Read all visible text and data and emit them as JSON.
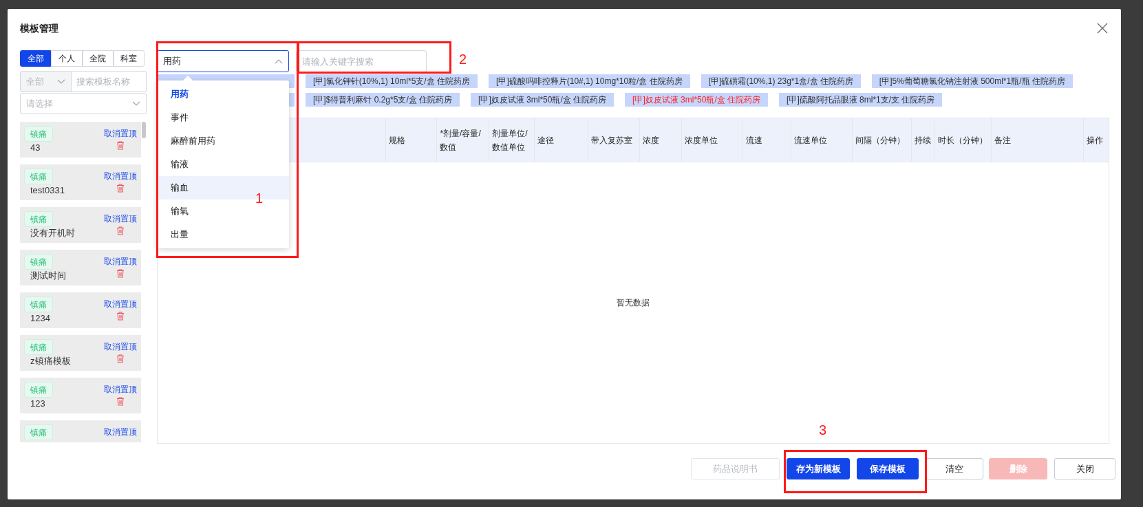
{
  "dialog": {
    "title": "模板管理"
  },
  "scope_tabs": [
    {
      "label": "全部",
      "selected": true
    },
    {
      "label": "个人",
      "selected": false
    },
    {
      "label": "全院",
      "selected": false
    },
    {
      "label": "科室",
      "selected": false
    }
  ],
  "filter": {
    "category": "全部",
    "search_placeholder": "搜索模板名称",
    "select_placeholder": "请选择"
  },
  "templates": [
    {
      "tag": "镇痛",
      "name": "43",
      "action": "取消置顶"
    },
    {
      "tag": "镇痛",
      "name": "test0331",
      "action": "取消置顶"
    },
    {
      "tag": "镇痛",
      "name": "没有开机时",
      "action": "取消置顶"
    },
    {
      "tag": "镇痛",
      "name": "测试时间",
      "action": "取消置顶"
    },
    {
      "tag": "镇痛",
      "name": "1234",
      "action": "取消置顶"
    },
    {
      "tag": "镇痛",
      "name": "z镇痛模板",
      "action": "取消置顶"
    },
    {
      "tag": "镇痛",
      "name": "123",
      "action": "取消置顶"
    },
    {
      "tag": "镇痛",
      "action": "取消置顶"
    }
  ],
  "type_select": {
    "value": "用药",
    "expanded": true,
    "options": [
      {
        "label": "用药",
        "selected": true,
        "hovered": false
      },
      {
        "label": "事件",
        "selected": false,
        "hovered": false
      },
      {
        "label": "麻醉前用药",
        "selected": false,
        "hovered": false
      },
      {
        "label": "输液",
        "selected": false,
        "hovered": false
      },
      {
        "label": "输血",
        "selected": false,
        "hovered": true
      },
      {
        "label": "输氧",
        "selected": false,
        "hovered": false
      },
      {
        "label": "出量",
        "selected": false,
        "hovered": false
      }
    ]
  },
  "keyword_search": {
    "placeholder": "请输入关键字搜索"
  },
  "drug_tags": [
    [
      {
        "text": "[甲]氯化钾针(10%,1) 10ml*5支/盒 住院药房",
        "color": "#333333"
      },
      {
        "text": "[甲]硫酸吗啡控释片(10#,1) 10mg*10粒/盒 住院药房",
        "color": "#333333"
      },
      {
        "text": "[甲]硫磺霜(10%,1) 23g*1盒/盒 住院药房",
        "color": "#333333"
      },
      {
        "text": "[甲]5%葡萄糖氯化钠注射液 500ml*1瓶/瓶 住院药房",
        "color": "#333333"
      }
    ],
    [
      {
        "text": "[甲]$得普利麻针 0.2g*5支/盒 住院药房",
        "color": "#333333"
      },
      {
        "text": "[甲]奴皮试液 3ml*50瓶/盒 住院药房",
        "color": "#333333"
      },
      {
        "text": "[甲]奴皮试液 3ml*50瓶/盒 住院药房",
        "color": "#ff2020"
      },
      {
        "text": "[甲]硫酸阿托品眼液 8ml*1支/支 住院药房",
        "color": "#333333"
      }
    ]
  ],
  "table": {
    "columns": [
      "",
      "规格",
      "*剂量/容量/数值",
      "剂量单位/数值单位",
      "途径",
      "带入复苏室",
      "浓度",
      "浓度单位",
      "流速",
      "流速单位",
      "间隔（分钟）",
      "持续",
      "时长（分钟）",
      "备注",
      "操作"
    ],
    "empty_text": "暂无数据"
  },
  "buttons": [
    {
      "label": "药品说明书",
      "kind": "default",
      "disabled": true
    },
    {
      "label": "存为新模板",
      "kind": "primary",
      "disabled": false
    },
    {
      "label": "保存模板",
      "kind": "primary",
      "disabled": false
    },
    {
      "label": "清空",
      "kind": "default",
      "disabled": false
    },
    {
      "label": "删除",
      "kind": "danger",
      "disabled": true
    },
    {
      "label": "关闭",
      "kind": "default",
      "disabled": false
    }
  ],
  "annotations": [
    "1",
    "2",
    "3"
  ]
}
